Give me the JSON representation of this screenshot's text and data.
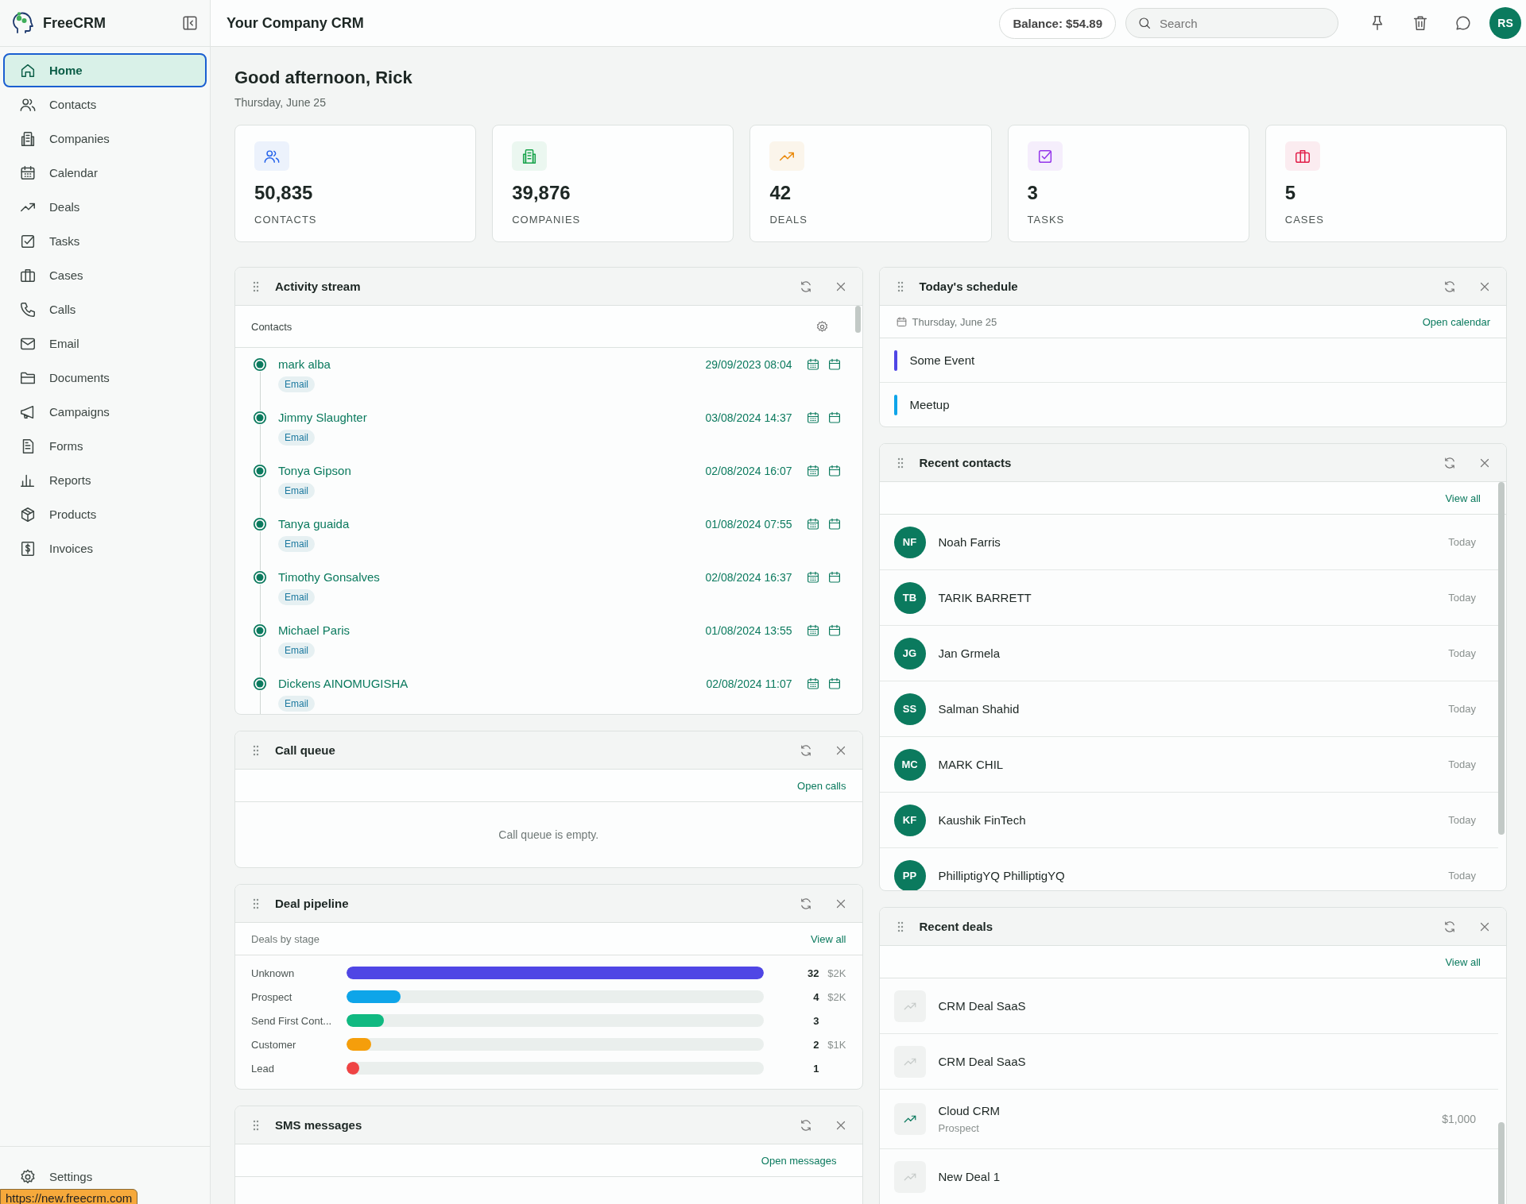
{
  "app": {
    "name": "FreeCRM"
  },
  "topbar": {
    "title": "Your Company CRM",
    "balance": "Balance: $54.89",
    "search": {
      "placeholder": "Search"
    },
    "avatar": "RS"
  },
  "sidebar": {
    "items": [
      {
        "label": "Home",
        "selected": true
      },
      {
        "label": "Contacts",
        "selected": false
      },
      {
        "label": "Companies",
        "selected": false
      },
      {
        "label": "Calendar",
        "selected": false
      },
      {
        "label": "Deals",
        "selected": false
      },
      {
        "label": "Tasks",
        "selected": false
      },
      {
        "label": "Cases",
        "selected": false
      },
      {
        "label": "Calls",
        "selected": false
      },
      {
        "label": "Email",
        "selected": false
      },
      {
        "label": "Documents",
        "selected": false
      },
      {
        "label": "Campaigns",
        "selected": false
      },
      {
        "label": "Forms",
        "selected": false
      },
      {
        "label": "Reports",
        "selected": false
      },
      {
        "label": "Products",
        "selected": false
      },
      {
        "label": "Invoices",
        "selected": false
      }
    ],
    "footer": {
      "label": "Settings"
    }
  },
  "greeting": {
    "title": "Good afternoon, Rick",
    "date": "Thursday, June 25"
  },
  "stats": [
    {
      "value": "50,835",
      "label": "CONTACTS",
      "color": "#2563eb"
    },
    {
      "value": "39,876",
      "label": "COMPANIES",
      "color": "#16a34a"
    },
    {
      "value": "42",
      "label": "DEALS",
      "color": "#ea8a0c"
    },
    {
      "value": "3",
      "label": "TASKS",
      "color": "#9333ea"
    },
    {
      "value": "5",
      "label": "CASES",
      "color": "#e11d48"
    }
  ],
  "activity_stream": {
    "title": "Activity stream",
    "filter": "Contacts",
    "items": [
      {
        "name": "mark alba",
        "tag": "Email",
        "date": "29/09/2023 08:04"
      },
      {
        "name": "Jimmy Slaughter",
        "tag": "Email",
        "date": "03/08/2024 14:37"
      },
      {
        "name": "Tonya Gipson",
        "tag": "Email",
        "date": "02/08/2024 16:07"
      },
      {
        "name": "Tanya guaida",
        "tag": "Email",
        "date": "01/08/2024 07:55"
      },
      {
        "name": "Timothy Gonsalves",
        "tag": "Email",
        "date": "02/08/2024 16:37"
      },
      {
        "name": "Michael Paris",
        "tag": "Email",
        "date": "01/08/2024 13:55"
      },
      {
        "name": "Dickens AINOMUGISHA",
        "tag": "Email",
        "date": "02/08/2024 11:07"
      }
    ]
  },
  "call_queue": {
    "title": "Call queue",
    "link": "Open calls",
    "empty": "Call queue is empty."
  },
  "deal_pipeline": {
    "title": "Deal pipeline",
    "subtitle": "Deals by stage",
    "link": "View all",
    "stages": [
      {
        "label": "Unknown",
        "level": 1.0,
        "color": "#4f46e5",
        "count": "32",
        "amount": "$2K"
      },
      {
        "label": "Prospect",
        "level": 0.13,
        "color": "#0ea5e9",
        "count": "4",
        "amount": "$2K"
      },
      {
        "label": "Send First Cont...",
        "level": 0.09,
        "color": "#10b981",
        "count": "3"
      },
      {
        "label": "Customer",
        "level": 0.06,
        "color": "#f59e0b",
        "count": "2",
        "amount": "$1K"
      },
      {
        "label": "Lead",
        "level": 0.03,
        "color": "#ef4444",
        "count": "1"
      }
    ]
  },
  "sms_messages": {
    "title": "SMS messages",
    "link": "Open messages"
  },
  "todays_schedule": {
    "title": "Today's schedule",
    "date": "Thursday, June 25",
    "link": "Open calendar",
    "events": [
      {
        "title": "Some Event",
        "color": "#4f46e5"
      },
      {
        "title": "Meetup",
        "color": "#0ea5e9"
      }
    ]
  },
  "recent_contacts": {
    "title": "Recent contacts",
    "link": "View all",
    "items": [
      {
        "initials": "NF",
        "name": "Noah Farris",
        "when": "Today"
      },
      {
        "initials": "TB",
        "name": "TARIK BARRETT",
        "when": "Today"
      },
      {
        "initials": "JG",
        "name": "Jan Grmela",
        "when": "Today"
      },
      {
        "initials": "SS",
        "name": "Salman Shahid",
        "when": "Today"
      },
      {
        "initials": "MC",
        "name": "MARK CHIL",
        "when": "Today"
      },
      {
        "initials": "KF",
        "name": "Kaushik FinTech",
        "when": "Today"
      },
      {
        "initials": "PP",
        "name": "PhilliptigYQ PhilliptigYQ",
        "when": "Today"
      }
    ]
  },
  "recent_deals": {
    "title": "Recent deals",
    "link": "View all",
    "items": [
      {
        "name": "CRM Deal SaaS",
        "active": false
      },
      {
        "name": "CRM Deal SaaS",
        "active": false
      },
      {
        "name": "Cloud CRM",
        "stage": "Prospect",
        "amount": "$1,000",
        "active": true
      },
      {
        "name": "New Deal 1",
        "active": false
      }
    ]
  },
  "status_url": "https://new.freecrm.com"
}
